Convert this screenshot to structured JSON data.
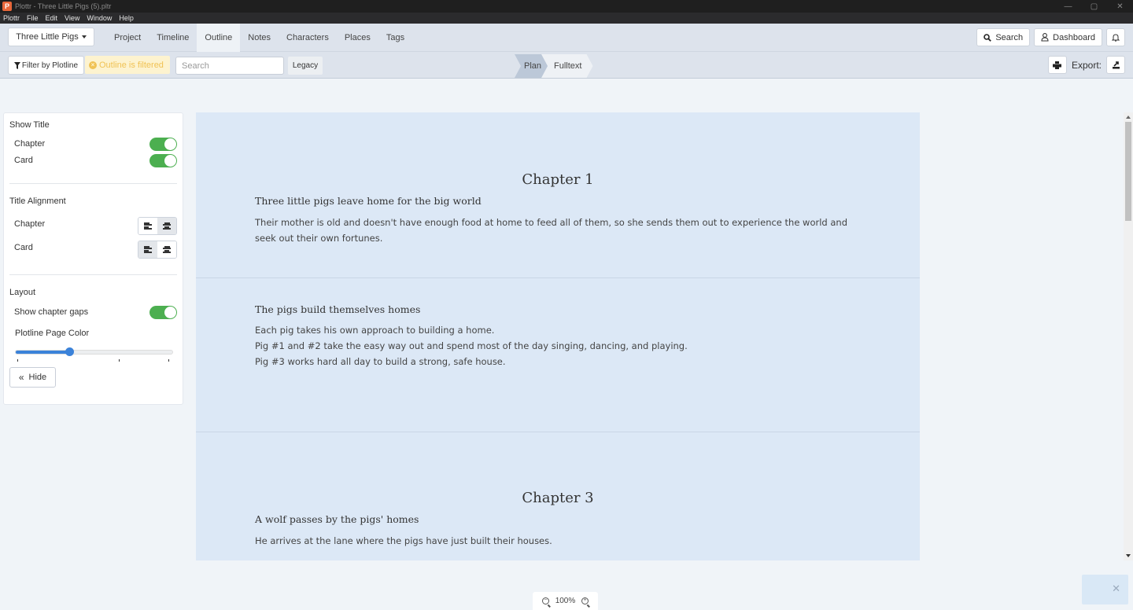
{
  "window": {
    "title": "Plottr - Three Little Pigs (5).pltr",
    "app_icon": "P",
    "controls": {
      "minimize": "—",
      "maximize": "▢",
      "close": "✕"
    }
  },
  "menubar": [
    "Plottr",
    "File",
    "Edit",
    "View",
    "Window",
    "Help"
  ],
  "navbar": {
    "project_name": "Three Little Pigs",
    "tabs": [
      {
        "label": "Project",
        "active": false
      },
      {
        "label": "Timeline",
        "active": false
      },
      {
        "label": "Outline",
        "active": true
      },
      {
        "label": "Notes",
        "active": false
      },
      {
        "label": "Characters",
        "active": false
      },
      {
        "label": "Places",
        "active": false
      },
      {
        "label": "Tags",
        "active": false
      }
    ],
    "search_label": "Search",
    "dashboard_label": "Dashboard"
  },
  "toolbar": {
    "filter_label": "Filter by Plotline",
    "filtered_badge": "Outline is filtered",
    "search_placeholder": "Search",
    "legacy_label": "Legacy",
    "breadcrumb": [
      "Plan",
      "Fulltext"
    ],
    "export_label": "Export:"
  },
  "sidepanel": {
    "show_title": {
      "heading": "Show Title",
      "chapter_label": "Chapter",
      "chapter_on": true,
      "card_label": "Card",
      "card_on": true
    },
    "title_alignment": {
      "heading": "Title Alignment",
      "chapter_label": "Chapter",
      "chapter_value": "center",
      "card_label": "Card",
      "card_value": "left"
    },
    "layout": {
      "heading": "Layout",
      "chapter_gaps_label": "Show chapter gaps",
      "chapter_gaps_on": true,
      "page_color_label": "Plotline Page Color",
      "page_color_value": 0.34
    },
    "hide_label": "Hide"
  },
  "outline": {
    "chapters": [
      {
        "title": "Chapter 1",
        "card_title": "Three little pigs leave home for the big world",
        "body": [
          "Their mother is old and doesn't have enough food at home to feed all of them, so she sends them out to experience the world and seek out their own fortunes."
        ]
      },
      {
        "title": "",
        "card_title": "The pigs build themselves homes",
        "body": [
          "Each pig takes his own approach to building a home.",
          "Pig #1 and #2 take the easy way out and spend most of the day singing, dancing, and playing.",
          "Pig #3 works hard all day to build a strong, safe house."
        ]
      },
      {
        "title": "Chapter 3",
        "card_title": "A wolf passes by the pigs' homes",
        "body": [
          "He arrives at the lane where the pigs have just built their houses."
        ]
      }
    ]
  },
  "zoom": {
    "value": "100%"
  }
}
